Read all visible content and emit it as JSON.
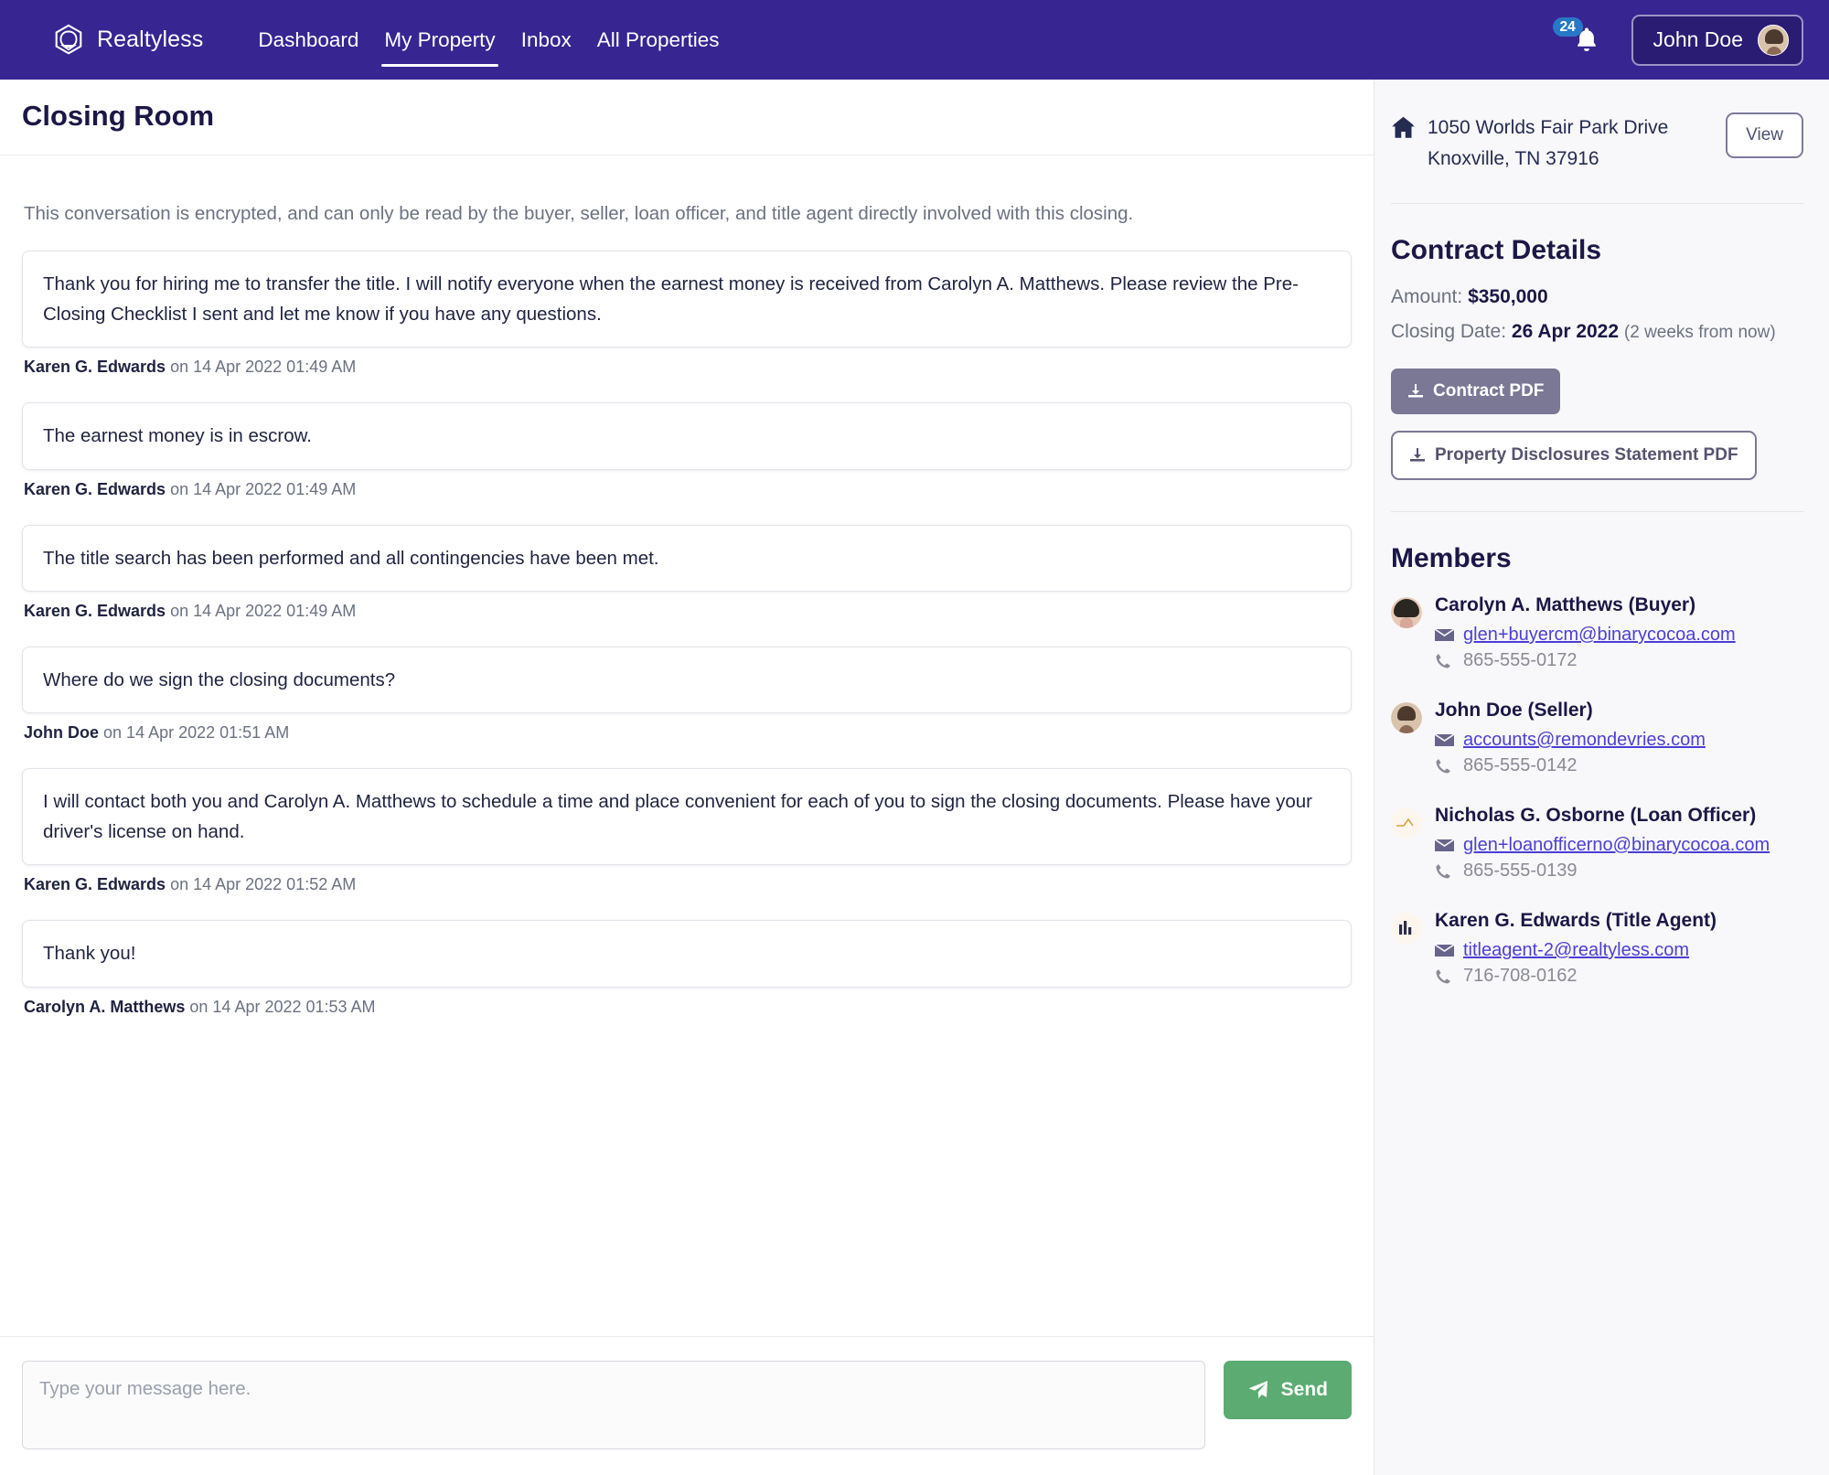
{
  "navbar": {
    "brand": "Realtyless",
    "brand_logo_icon": "hexagon-logo-icon",
    "links": [
      {
        "label": "Dashboard",
        "active": false
      },
      {
        "label": "My Property",
        "active": true
      },
      {
        "label": "Inbox",
        "active": false
      },
      {
        "label": "All Properties",
        "active": false
      }
    ],
    "notifications": {
      "count": "24",
      "icon": "bell-icon"
    },
    "user": {
      "name": "John Doe",
      "avatar": "user-avatar"
    }
  },
  "main": {
    "page_title": "Closing Room",
    "encryption_note": "This conversation is encrypted, and can only be read by the buyer, seller, loan officer, and title agent directly involved with this closing.",
    "messages": [
      {
        "text": "Thank you for hiring me to transfer the title. I will notify everyone when the earnest money is received from Carolyn A. Matthews. Please review the Pre-Closing Checklist I sent and let me know if you have any questions.",
        "author": "Karen G. Edwards",
        "timestamp": "on 14 Apr 2022 01:49 AM"
      },
      {
        "text": "The earnest money is in escrow.",
        "author": "Karen G. Edwards",
        "timestamp": "on 14 Apr 2022 01:49 AM"
      },
      {
        "text": "The title search has been performed and all contingencies have been met.",
        "author": "Karen G. Edwards",
        "timestamp": "on 14 Apr 2022 01:49 AM"
      },
      {
        "text": "Where do we sign the closing documents?",
        "author": "John Doe",
        "timestamp": "on 14 Apr 2022 01:51 AM"
      },
      {
        "text": "I will contact both you and Carolyn A. Matthews to schedule a time and place convenient for each of you to sign the closing documents. Please have your driver's license on hand.",
        "author": "Karen G. Edwards",
        "timestamp": "on 14 Apr 2022 01:52 AM"
      },
      {
        "text": "Thank you!",
        "author": "Carolyn A. Matthews",
        "timestamp": "on 14 Apr 2022 01:53 AM"
      }
    ],
    "composer": {
      "placeholder": "Type your message here.",
      "value": "",
      "send_label": "Send",
      "send_icon": "paper-plane-icon"
    }
  },
  "sidebar": {
    "property": {
      "icon": "home-icon",
      "address_line1": "1050 Worlds Fair Park Drive",
      "address_line2": "Knoxville, TN 37916",
      "view_label": "View"
    },
    "contract": {
      "title": "Contract Details",
      "amount_label": "Amount:",
      "amount_value": "$350,000",
      "closing_label": "Closing Date:",
      "closing_value": "26 Apr 2022",
      "closing_note": "(2 weeks from now)",
      "contract_pdf_label": "Contract PDF",
      "disclosures_pdf_label": "Property Disclosures Statement PDF",
      "download_icon": "download-icon"
    },
    "members": {
      "title": "Members",
      "list": [
        {
          "name": "Carolyn A. Matthews (Buyer)",
          "email": "glen+buyercm@binarycocoa.com",
          "phone": "865-555-0172",
          "avatar_kind": "photo-female"
        },
        {
          "name": "John Doe (Seller)",
          "email": "accounts@remondevries.com",
          "phone": "865-555-0142",
          "avatar_kind": "photo-male"
        },
        {
          "name": "Nicholas G. Osborne (Loan Officer)",
          "email": "glen+loanofficerno@binarycocoa.com",
          "phone": "865-555-0139",
          "avatar_kind": "chart-line"
        },
        {
          "name": "Karen G. Edwards (Title Agent)",
          "email": "titleagent-2@realtyless.com",
          "phone": "716-708-0162",
          "avatar_kind": "bar-chart"
        }
      ]
    }
  },
  "colors": {
    "nav_purple": "#372592",
    "accent_green": "#5cab72",
    "badge_blue": "#2878c8",
    "link_purple": "#4b3fd4",
    "sidebar_bg": "#f8f8fa",
    "heading_navy": "#1b1746",
    "pdf_gray": "#7a7895"
  }
}
